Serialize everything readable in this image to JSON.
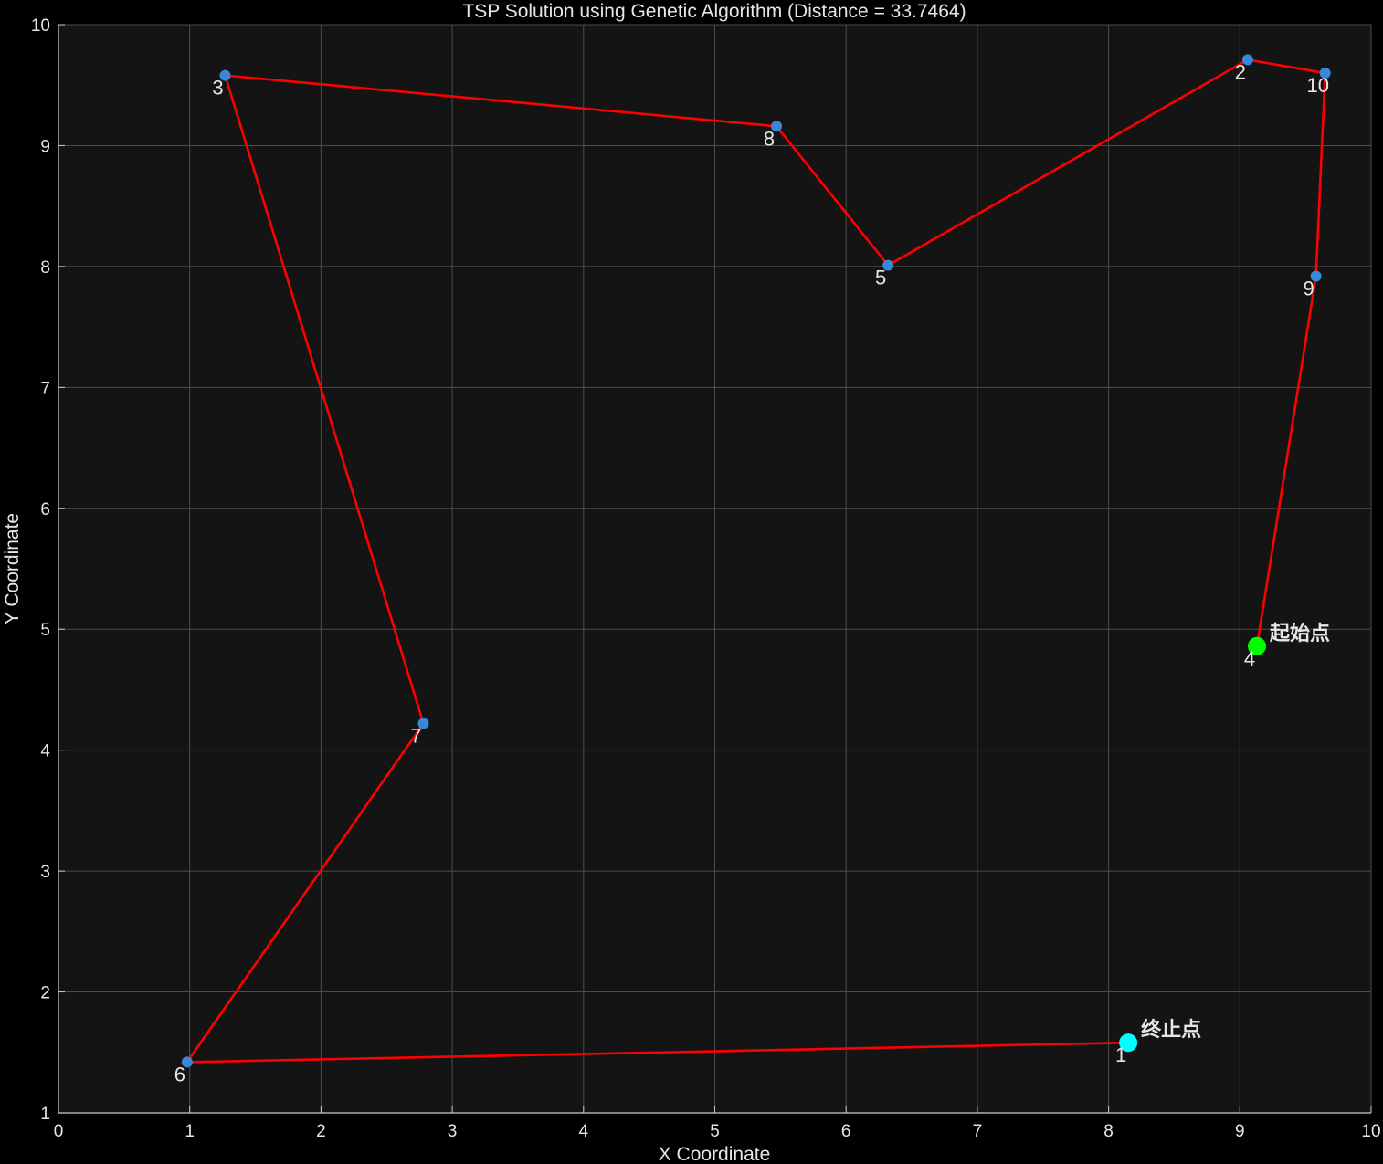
{
  "chart_data": {
    "type": "line",
    "title": "TSP Solution using Genetic Algorithm (Distance = 33.7464)",
    "xlabel": "X Coordinate",
    "ylabel": "Y Coordinate",
    "xlim": [
      0,
      10
    ],
    "ylim": [
      1,
      10
    ],
    "xticks": [
      "0",
      "1",
      "2",
      "3",
      "4",
      "5",
      "6",
      "7",
      "8",
      "9",
      "10"
    ],
    "yticks": [
      "1",
      "2",
      "3",
      "4",
      "5",
      "6",
      "7",
      "8",
      "9",
      "10"
    ],
    "grid": true,
    "cities": [
      {
        "label": "1",
        "x": 8.15,
        "y": 1.58
      },
      {
        "label": "2",
        "x": 9.06,
        "y": 9.71
      },
      {
        "label": "3",
        "x": 1.27,
        "y": 9.58
      },
      {
        "label": "4",
        "x": 9.13,
        "y": 4.86
      },
      {
        "label": "5",
        "x": 6.32,
        "y": 8.01
      },
      {
        "label": "6",
        "x": 0.98,
        "y": 1.42
      },
      {
        "label": "7",
        "x": 2.78,
        "y": 4.22
      },
      {
        "label": "8",
        "x": 5.47,
        "y": 9.16
      },
      {
        "label": "9",
        "x": 9.58,
        "y": 7.92
      },
      {
        "label": "10",
        "x": 9.65,
        "y": 9.6
      }
    ],
    "route": [
      "4",
      "9",
      "10",
      "2",
      "5",
      "8",
      "3",
      "7",
      "6",
      "1"
    ],
    "start": {
      "city": "4",
      "label": "起始点"
    },
    "end": {
      "city": "1",
      "label": "终止点"
    },
    "colors": {
      "background": "#000000",
      "plot_background": "#141414",
      "grid": "#4d4d4d",
      "axis": "#cccccc",
      "route": "#ff0000",
      "city": "#3a87d9",
      "start": "#00ff00",
      "end": "#00ffff",
      "text": "#e6e6e6"
    }
  }
}
